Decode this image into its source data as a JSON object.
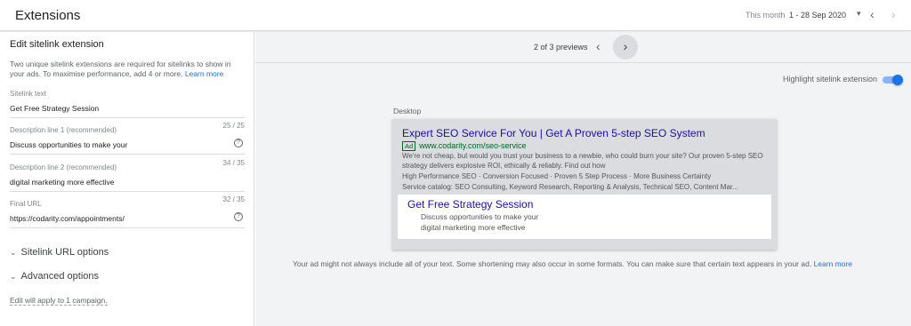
{
  "header": {
    "title": "Extensions",
    "date_label": "This month",
    "date_value": "1 - 28 Sep 2020",
    "caret_icon": "▾",
    "prev_icon": "‹",
    "next_icon": "›"
  },
  "left_panel": {
    "title": "Edit sitelink extension",
    "description": "Two unique sitelink extensions are required for sitelinks to show in your ads. To maximise performance, add 4 or more.",
    "learn_more": "Learn more",
    "fields": [
      {
        "label": "Sitelink text",
        "value": "Get Free Strategy Session",
        "count": ""
      },
      {
        "label": "Description line 1 (recommended)",
        "value": "Discuss opportunities to make your",
        "count": "25 / 25"
      },
      {
        "label": "Description line 2 (recommended)",
        "value": "digital marketing more effective",
        "count": "34 / 35"
      },
      {
        "label": "Final URL",
        "value": "https://codarity.com/appointments/",
        "count": "32 / 35"
      }
    ],
    "help_icon": "?",
    "expanders": [
      {
        "label": "Sitelink URL options",
        "icon": "⌄"
      },
      {
        "label": "Advanced options",
        "icon": "⌄"
      }
    ],
    "apply_note": "Edit will apply to 1 campaign."
  },
  "preview": {
    "count_text": "2 of 3 previews",
    "prev_icon": "‹",
    "next_icon": "›",
    "highlight_label": "Highlight sitelink extension",
    "highlight_on": true,
    "device_label": "Desktop",
    "ad": {
      "headline": "Expert SEO Service For You | Get A Proven 5-step SEO System",
      "badge": "Ad",
      "display_url": "www.codarity.com/seo-service",
      "description": "We're not cheap, but would you trust your business to a newbie, who could burn your site? Our proven 5-step SEO strategy delivers explosive ROI, ethically & reliably. Find out how",
      "callouts": "High Performance SEO · Conversion Focused · Proven 5 Step Process · More Business Certainty",
      "snippet": "Service catalog: SEO Consulting, Keyword Research, Reporting & Analysis, Technical SEO, Content Mar...",
      "sitelink": {
        "title": "Get Free Strategy Session",
        "line1": "Discuss opportunities to make your",
        "line2": "digital marketing more effective"
      }
    },
    "footnote": "Your ad might not always include all of your text. Some shortening may also occur in some formats. You can make sure that certain text appears in your ad.",
    "footnote_link": "Learn more"
  },
  "colors": {
    "accent": "#1a73e8",
    "ad_headline": "#1a0dab",
    "ad_url": "#006621"
  }
}
